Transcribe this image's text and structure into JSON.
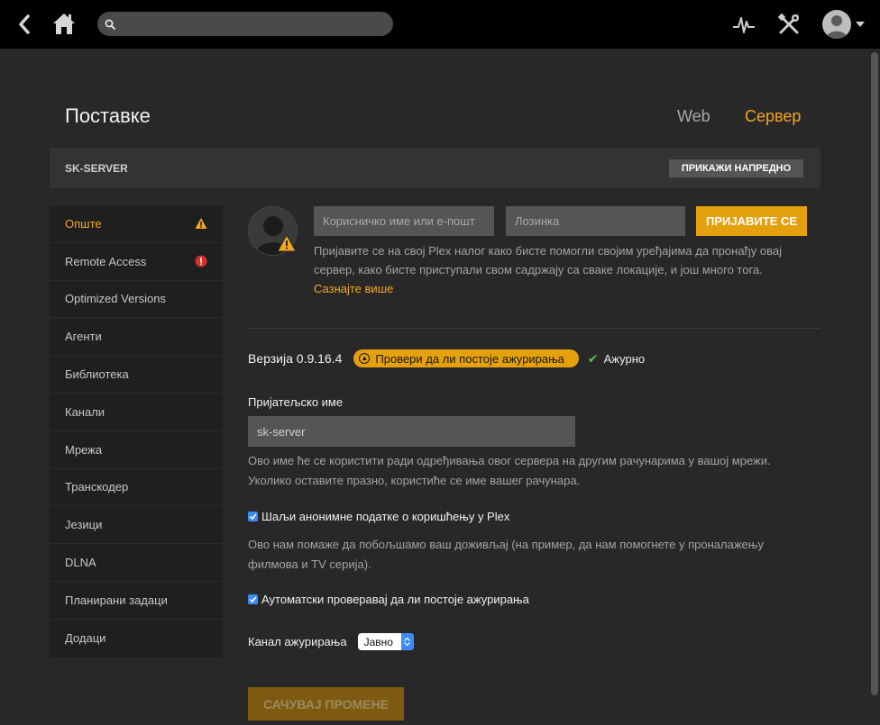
{
  "topbar": {
    "search_placeholder": "",
    "icons": [
      "back-icon",
      "home-icon",
      "search-icon",
      "activity-icon",
      "tools-icon",
      "user-avatar-icon",
      "caret-down-icon"
    ]
  },
  "header": {
    "title": "Поставке",
    "tabs": [
      {
        "label": "Web",
        "active": false
      },
      {
        "label": "Сервер",
        "active": true
      }
    ]
  },
  "server_bar": {
    "name": "SK-SERVER",
    "advanced_button": "ПРИКАЖИ НАПРЕДНО"
  },
  "sidebar": {
    "items": [
      {
        "label": "Опште",
        "active": true,
        "badge": "warning"
      },
      {
        "label": "Remote Access",
        "active": false,
        "badge": "error"
      },
      {
        "label": "Optimized Versions",
        "active": false,
        "badge": ""
      },
      {
        "label": "Агенти",
        "active": false,
        "badge": ""
      },
      {
        "label": "Библиотека",
        "active": false,
        "badge": ""
      },
      {
        "label": "Канали",
        "active": false,
        "badge": ""
      },
      {
        "label": "Мрежа",
        "active": false,
        "badge": ""
      },
      {
        "label": "Транскодер",
        "active": false,
        "badge": ""
      },
      {
        "label": "Језици",
        "active": false,
        "badge": ""
      },
      {
        "label": "DLNA",
        "active": false,
        "badge": ""
      },
      {
        "label": "Планирани задаци",
        "active": false,
        "badge": ""
      },
      {
        "label": "Додаци",
        "active": false,
        "badge": ""
      }
    ]
  },
  "login": {
    "username_placeholder": "Корисничко име или е-пошт",
    "password_placeholder": "Лозинка",
    "button": "ПРИЈАВИТЕ СЕ",
    "description": "Пријавите се на свој Plex налог како бисте помогли својим уређајима да пронађу овај сервер, како бисте приступали свом садржају са сваке локације, и још много тога.",
    "learn_more": "Сазнајте више"
  },
  "version": {
    "text": "Верзија 0.9.16.4",
    "check_button": "Провери да ли постоје ажурирања",
    "status": "Ажурно"
  },
  "friendly_name": {
    "label": "Пријатељско име",
    "value": "sk-server",
    "help": "Ово име ће се користити ради одређивања овог сервера на другим рачунарима у вашој мрежи. Уколико оставите празно, користиће се име вашег рачунара."
  },
  "anonymous": {
    "label": "Шаљи анонимне податке о коришћењу у Plex",
    "checked": true,
    "help": "Ово нам помаже да побољшамо ваш доживљај (на пример, да нам помогнете у проналажењу филмова и TV серија)."
  },
  "auto_update": {
    "label": "Аутоматски проверавај да ли постоје ажурирања",
    "checked": true
  },
  "channel": {
    "label": "Канал ажурирања",
    "selected": "Јавно"
  },
  "save_button": "САЧУВАЈ ПРОМЕНЕ",
  "colors": {
    "accent": "#e5a00d",
    "active_text": "#f5a623",
    "background": "#282828",
    "error": "#d0312d",
    "ok": "#5cb85c"
  }
}
